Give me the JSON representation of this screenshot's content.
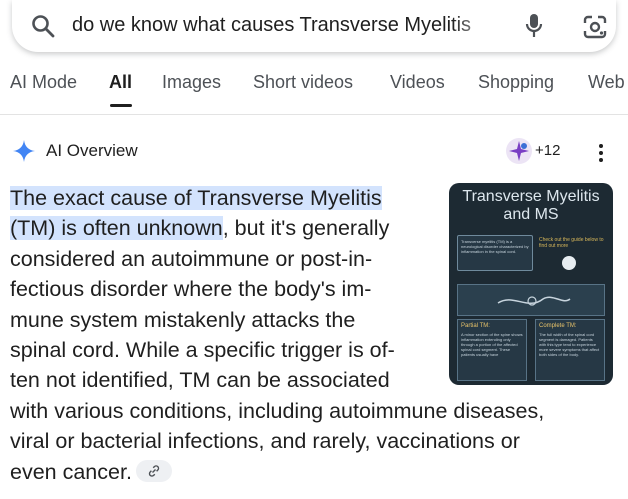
{
  "search": {
    "query": "do we know what causes Transverse Myelitis",
    "icons": [
      "search-icon",
      "microphone-icon",
      "google-lens-icon"
    ]
  },
  "tabs": [
    {
      "label": "AI Mode",
      "active": false
    },
    {
      "label": "All",
      "active": true
    },
    {
      "label": "Images",
      "active": false
    },
    {
      "label": "Short videos",
      "active": false
    },
    {
      "label": "Videos",
      "active": false
    },
    {
      "label": "Shopping",
      "active": false
    },
    {
      "label": "Web",
      "active": false
    }
  ],
  "ai_overview": {
    "title": "AI Overview",
    "sources_count": "+12",
    "answer_lines": [
      "The exact cause of Transverse Myelitis",
      "(TM) is often unknown",
      ", but it's generally",
      "considered an autoimmune or post-in-",
      "fectious disorder where the body's im-",
      "mune system mistakenly attacks the",
      "spinal cord. While a specific trigger is of-",
      "ten not identified, TM can be associated",
      "with various conditions, including autoimmune diseases,",
      "viral or bacterial infections, and rarely, vaccinations or",
      "even cancer."
    ],
    "thumbnail": {
      "title_line1": "Transverse Myelitis",
      "title_line2": "and MS",
      "box_text": "Transverse myelitis (TM) is a neurological disorder characterized by inflammation in the spinal cord.",
      "guide_text": "Check out the guide below to find out more",
      "col1_title": "Partial TM:",
      "col1_text": "A minor section of the spine shows inflammation extending only through a portion of the affected spinal cord segment. These patients usually have",
      "col2_title": "Complete TM:",
      "col2_text": "The full width of the spinal cord segment is damaged. Patients with this type tend to experience more severe symptoms that affect both sides of the body."
    }
  },
  "colors": {
    "highlight": "#d3e3fd",
    "sparkle": "#4285f4"
  }
}
